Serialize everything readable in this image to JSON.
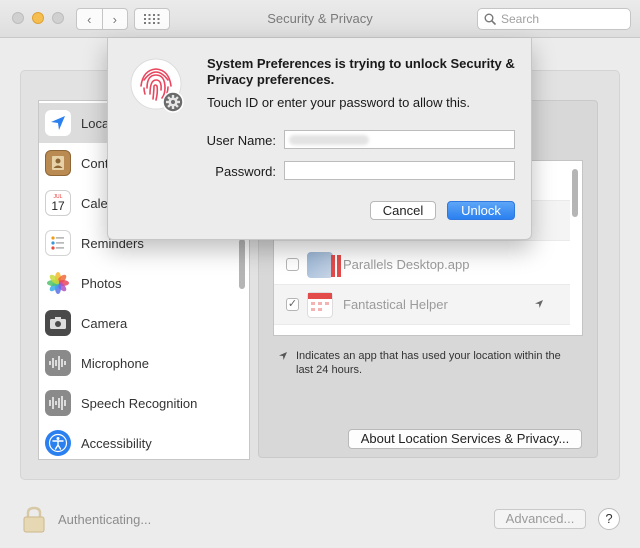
{
  "window": {
    "title": "Security & Privacy",
    "search_placeholder": "Search",
    "nav_back_glyph": "‹",
    "nav_forward_glyph": "›"
  },
  "sidebar": {
    "items": [
      {
        "label": "Location Services",
        "icon": "location-arrow-icon"
      },
      {
        "label": "Contacts",
        "icon": "contacts-book-icon"
      },
      {
        "label": "Calendars",
        "icon": "calendar-icon",
        "day_badge": "17",
        "month_badge": "JUL"
      },
      {
        "label": "Reminders",
        "icon": "reminders-list-icon"
      },
      {
        "label": "Photos",
        "icon": "photos-flower-icon"
      },
      {
        "label": "Camera",
        "icon": "camera-icon"
      },
      {
        "label": "Microphone",
        "icon": "microphone-waveform-icon"
      },
      {
        "label": "Speech Recognition",
        "icon": "speech-waveform-icon"
      },
      {
        "label": "Accessibility",
        "icon": "accessibility-figure-icon"
      }
    ]
  },
  "apps": [
    {
      "name": "Parallels Desktop.app",
      "checked": false,
      "checkmark": ""
    },
    {
      "name": "Fantastical Helper",
      "checked": true,
      "checkmark": "✓",
      "location_used": true
    }
  ],
  "hint_text": "Indicates an app that has used your location within the last 24 hours.",
  "about_button": "About Location Services & Privacy...",
  "footer": {
    "status_text": "Authenticating...",
    "advanced_button": "Advanced...",
    "help_button": "?"
  },
  "dialog": {
    "title": "System Preferences is trying to unlock Security & Privacy preferences.",
    "subtitle": "Touch ID or enter your password to allow this.",
    "username_label": "User Name:",
    "password_label": "Password:",
    "cancel_button": "Cancel",
    "unlock_button": "Unlock"
  },
  "colors": {
    "accent": "#2b80f0",
    "touchid": "#e8475f",
    "traffic_min": "#f5be4f"
  }
}
